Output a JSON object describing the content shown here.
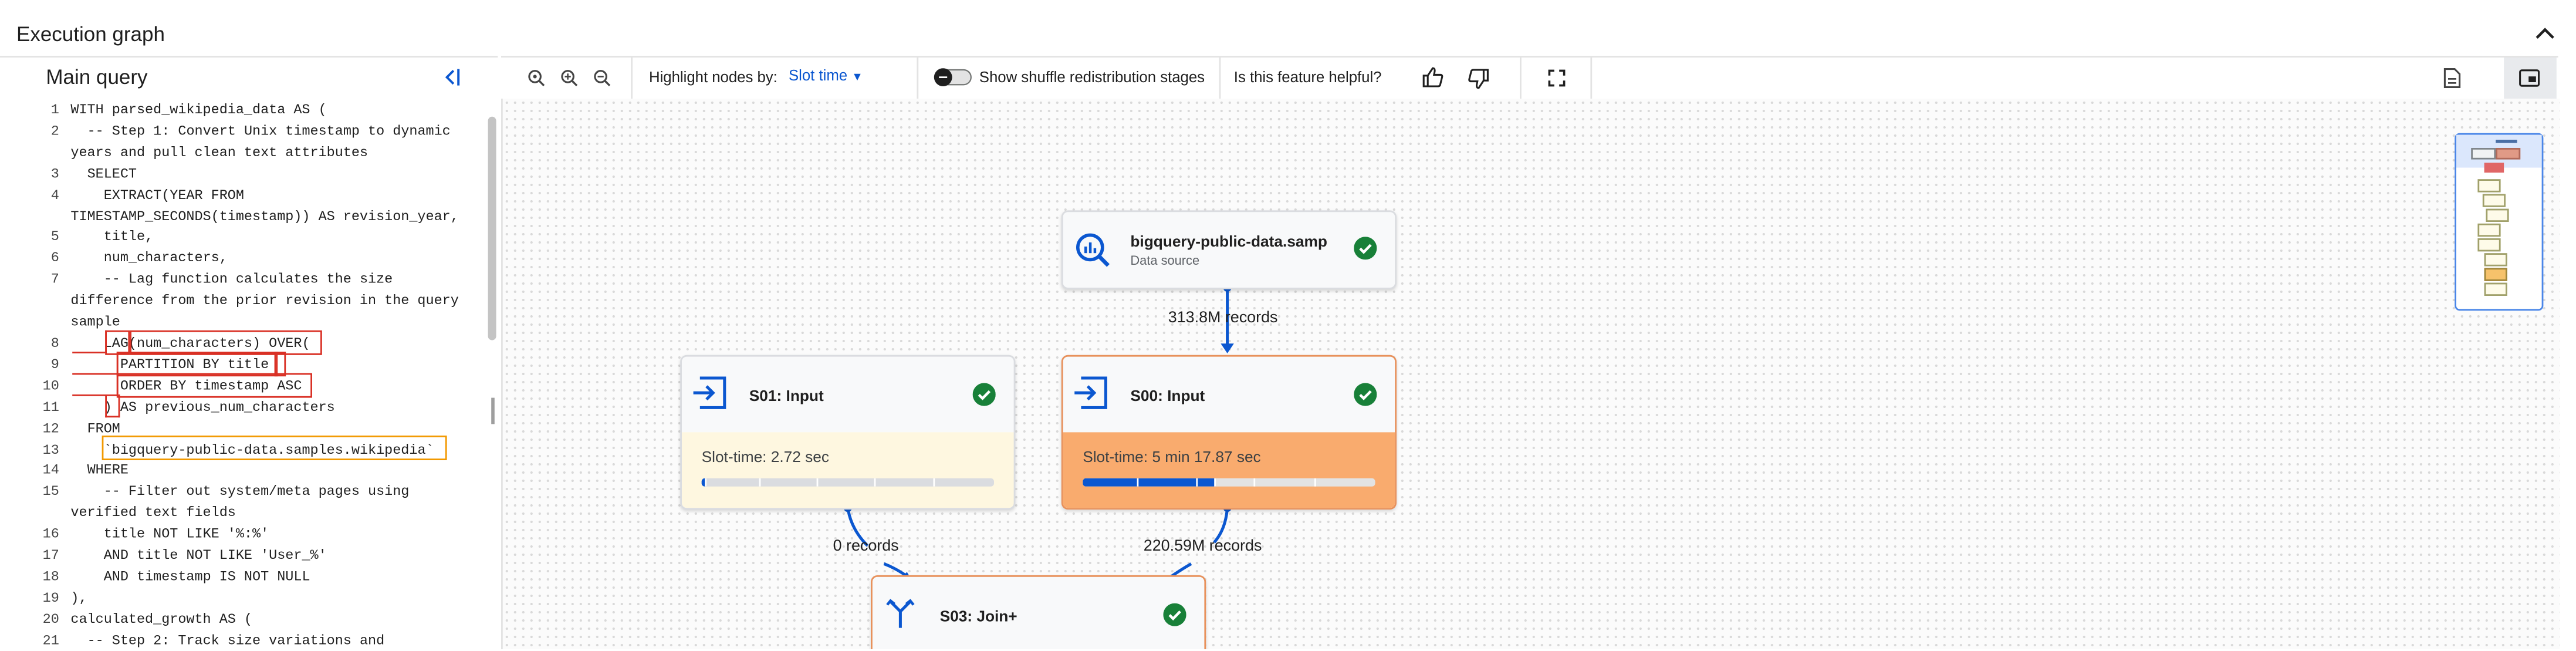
{
  "panel": {
    "title": "Execution graph"
  },
  "left": {
    "title": "Main query",
    "code_lines": [
      {
        "no": "1",
        "text": "WITH parsed_wikipedia_data AS ("
      },
      {
        "no": "2",
        "text": "  -- Step 1: Convert Unix timestamp to dynamic years and pull clean text attributes"
      },
      {
        "no": "3",
        "text": "  SELECT"
      },
      {
        "no": "4",
        "text": "    EXTRACT(YEAR FROM TIMESTAMP_SECONDS(timestamp)) AS revision_year,"
      },
      {
        "no": "5",
        "text": "    title,"
      },
      {
        "no": "6",
        "text": "    num_characters,"
      },
      {
        "no": "7",
        "text": "    -- Lag function calculates the size difference from the prior revision in the query sample"
      },
      {
        "no": "8",
        "text": "    LAG(num_characters) OVER("
      },
      {
        "no": "9",
        "text": "      PARTITION BY title"
      },
      {
        "no": "10",
        "text": "      ORDER BY timestamp ASC"
      },
      {
        "no": "11",
        "text": "    ) AS previous_num_characters"
      },
      {
        "no": "12",
        "text": "  FROM"
      },
      {
        "no": "13",
        "text": "    `bigquery-public-data.samples.wikipedia`"
      },
      {
        "no": "14",
        "text": "  WHERE"
      },
      {
        "no": "15",
        "text": "    -- Filter out system/meta pages using verified text fields"
      },
      {
        "no": "16",
        "text": "    title NOT LIKE '%:%'"
      },
      {
        "no": "17",
        "text": "    AND title NOT LIKE 'User_%'"
      },
      {
        "no": "18",
        "text": "    AND timestamp IS NOT NULL"
      },
      {
        "no": "19",
        "text": "),"
      },
      {
        "no": "20",
        "text": "calculated_growth AS ("
      },
      {
        "no": "21",
        "text": "  -- Step 2: Track size variations and"
      }
    ]
  },
  "toolbar": {
    "highlight_label": "Highlight nodes by:",
    "highlight_value": "Slot time",
    "shuffle_label": "Show shuffle redistribution stages",
    "feedback_label": "Is this feature helpful?"
  },
  "graph": {
    "datasource": {
      "name": "bigquery-public-data.samp",
      "type": "Data source"
    },
    "s01": {
      "name": "S01: Input",
      "slot": "Slot-time: 2.72 sec"
    },
    "s00": {
      "name": "S00: Input",
      "slot": "Slot-time: 5 min 17.87 sec"
    },
    "s03": {
      "name": "S03: Join+"
    },
    "edges": {
      "ds_to_s00": "313.8M records",
      "s01_to_s03": "0 records",
      "s00_to_s03": "220.59M records"
    }
  },
  "colors": {
    "accent": "#0b57d0",
    "success": "#188038",
    "s01_fill": "#fef7e0",
    "s00_fill": "#f9ab6e",
    "s00_border": "#e8915b",
    "highlight_box": "#d93025",
    "table_box": "#f29900"
  }
}
